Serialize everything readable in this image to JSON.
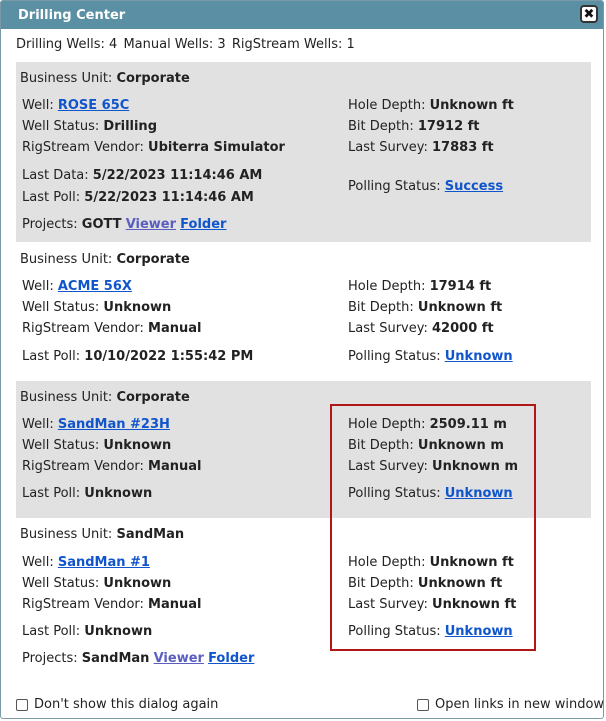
{
  "dialog": {
    "title": "Drilling Center",
    "close_glyph": "✖"
  },
  "counts": {
    "drilling": "Drilling Wells: 4",
    "manual": "Manual Wells: 3",
    "rigstream": "RigStream Wells: 1"
  },
  "labels": {
    "business_unit": "Business Unit:",
    "well": "Well:",
    "well_status": "Well Status:",
    "vendor": "RigStream Vendor:",
    "last_data": "Last Data:",
    "last_poll": "Last Poll:",
    "projects": "Projects:",
    "hole_depth": "Hole Depth:",
    "bit_depth": "Bit Depth:",
    "last_survey": "Last Survey:",
    "polling_status": "Polling Status:"
  },
  "wells": [
    {
      "business_unit": "Corporate",
      "well": "ROSE 65C",
      "status": "Drilling",
      "vendor": "Ubiterra Simulator",
      "last_data": "5/22/2023 11:14:46 AM",
      "last_poll": "5/22/2023 11:14:46 AM",
      "project": "GOTT",
      "viewer": "Viewer",
      "folder": "Folder",
      "hole_depth": "Unknown ft",
      "bit_depth": "17912 ft",
      "last_survey": "17883 ft",
      "polling_status": "Success"
    },
    {
      "business_unit": "Corporate",
      "well": "ACME 56X",
      "status": "Unknown",
      "vendor": "Manual",
      "last_poll": "10/10/2022 1:55:42 PM",
      "hole_depth": "17914 ft",
      "bit_depth": "Unknown ft",
      "last_survey": "42000 ft",
      "polling_status": "Unknown"
    },
    {
      "business_unit": "Corporate",
      "well": "SandMan #23H",
      "status": "Unknown",
      "vendor": "Manual",
      "last_poll": "Unknown",
      "hole_depth": "2509.11 m",
      "bit_depth": "Unknown m",
      "last_survey": "Unknown m",
      "polling_status": "Unknown"
    },
    {
      "business_unit": "SandMan",
      "well": "SandMan #1",
      "status": "Unknown",
      "vendor": "Manual",
      "last_poll": "Unknown",
      "project": "SandMan",
      "viewer": "Viewer",
      "folder": "Folder",
      "hole_depth": "Unknown ft",
      "bit_depth": "Unknown ft",
      "last_survey": "Unknown ft",
      "polling_status": "Unknown"
    }
  ],
  "footer": {
    "dont_show": "Don't show this dialog again",
    "open_links": "Open links in new window"
  },
  "colors": {
    "titlebar": "#5b8fa3",
    "link": "#1155cc",
    "highlight": "#b01818",
    "grey_panel": "#e1e1e1"
  }
}
